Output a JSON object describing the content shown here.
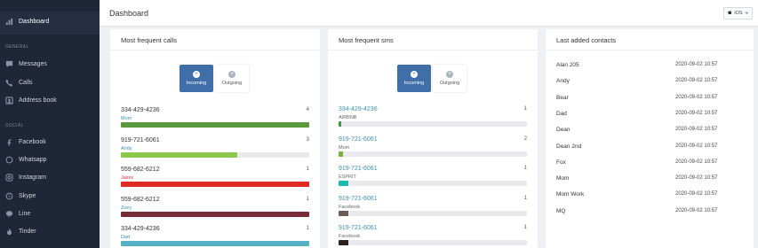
{
  "sidebar": {
    "dashboard": "Dashboard",
    "general_section": "GENERAL",
    "messages": "Messages",
    "calls": "Calls",
    "address_book": "Address book",
    "social_section": "SOCIAL",
    "facebook": "Facebook",
    "whatsapp": "Whatsapp",
    "instagram": "Instagram",
    "skype": "Skype",
    "line": "Line",
    "tinder": "Tinder"
  },
  "header": {
    "title": "Dashboard",
    "os_select": "iOS"
  },
  "calls": {
    "title": "Most frequent calls",
    "tab_incoming": "Incoming",
    "tab_outgoing": "Outgoing",
    "items": [
      {
        "number": "334-429-4236",
        "label": "Mom",
        "count": "4",
        "level": 1.0,
        "color": "#5a9a3c",
        "label_color": "#3a8fb7"
      },
      {
        "number": "919-721-6061",
        "label": "Andy",
        "count": "3",
        "level": 0.62,
        "color": "#8cc84b",
        "label_color": "#3a8fb7"
      },
      {
        "number": "559-682-6212",
        "label": "Jaxxx",
        "count": "1",
        "level": 1.0,
        "color": "#e02b24",
        "label_color": "#e02b24"
      },
      {
        "number": "559-682-6212",
        "label": "Zoey",
        "count": "1",
        "level": 1.0,
        "color": "#7a2b38",
        "label_color": "#3a8fb7"
      },
      {
        "number": "334-429-4236",
        "label": "Dad",
        "count": "1",
        "level": 1.0,
        "color": "#56b1c4",
        "label_color": "#3a8fb7"
      }
    ]
  },
  "sms": {
    "title": "Most frequent sms",
    "tab_incoming": "Incoming",
    "tab_outgoing": "Outgoing",
    "items": [
      {
        "number": "334-429-4236",
        "label": "AIRBNB",
        "count": "1",
        "level": 0.015,
        "color": "#3f9a3c"
      },
      {
        "number": "919-721-6061",
        "label": "Mom",
        "count": "2",
        "level": 0.025,
        "color": "#7bb23b"
      },
      {
        "number": "919-721-6061",
        "label": "ESPRIT",
        "count": "1",
        "level": 0.05,
        "color": "#1bbcb0"
      },
      {
        "number": "919-721-6061",
        "label": "Facebook",
        "count": "1",
        "level": 0.05,
        "color": "#6d5a55"
      },
      {
        "number": "919-721-6061",
        "label": "Facebook",
        "count": "1",
        "level": 0.05,
        "color": "#2b2220"
      }
    ]
  },
  "contacts": {
    "title": "Last added contacts",
    "items": [
      {
        "name": "Alan 205",
        "date": "2020-09-02 10:57"
      },
      {
        "name": "Andy",
        "date": "2020-09-02 10:57"
      },
      {
        "name": "Bear",
        "date": "2020-09-02 10:57"
      },
      {
        "name": "Dad",
        "date": "2020-09-02 10:57"
      },
      {
        "name": "Dean",
        "date": "2020-09-02 10:57"
      },
      {
        "name": "Dean 2nd",
        "date": "2020-09-02 10:57"
      },
      {
        "name": "Fox",
        "date": "2020-09-02 10:57"
      },
      {
        "name": "Mom",
        "date": "2020-09-02 10:57"
      },
      {
        "name": "Mom Work",
        "date": "2020-09-02 10:57"
      },
      {
        "name": "MQ",
        "date": "2020-09-02 10:57"
      }
    ]
  }
}
